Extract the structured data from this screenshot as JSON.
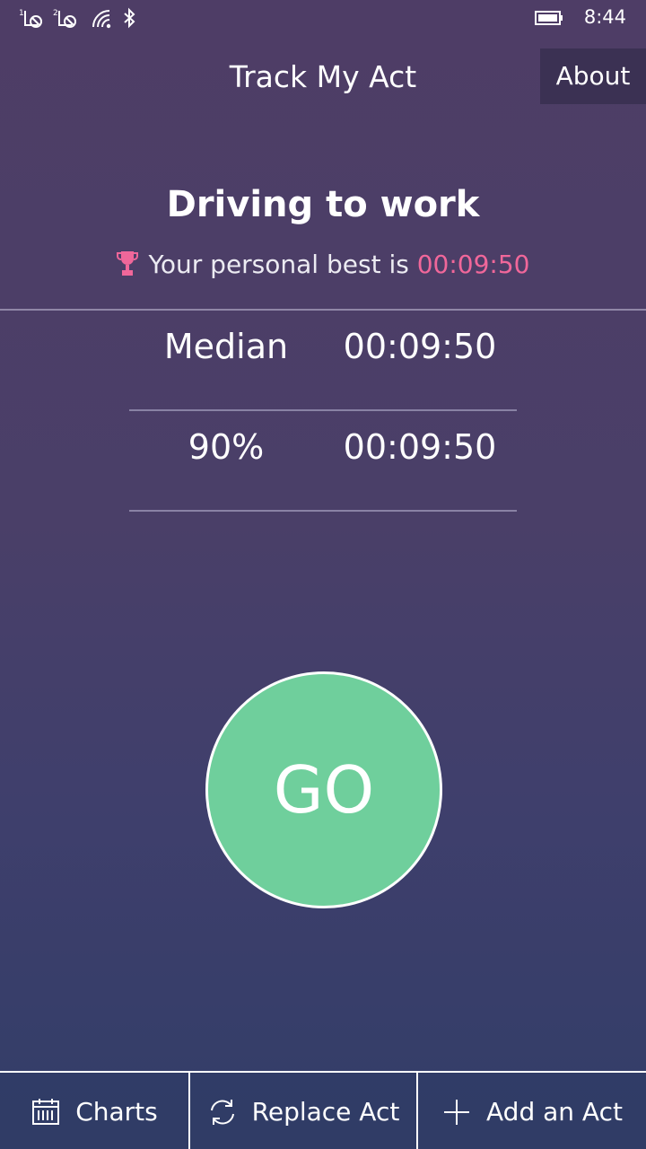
{
  "status_bar": {
    "time": "8:44",
    "sim1_label": "1",
    "sim2_label": "2",
    "icons": [
      "sim1-no-service-icon",
      "sim2-no-service-icon",
      "wifi-icon",
      "bluetooth-icon",
      "battery-icon"
    ]
  },
  "header": {
    "app_title": "Track My Act",
    "about_label": "About"
  },
  "act": {
    "title": "Driving to work",
    "best_prefix": "Your personal best is ",
    "best_value": "00:09:50",
    "best_color": "#f0679a",
    "trophy_icon": "trophy-icon"
  },
  "stats": [
    {
      "label": "Median",
      "value": "00:09:50"
    },
    {
      "label": "90%",
      "value": "00:09:50"
    }
  ],
  "go_button": {
    "label": "GO",
    "color": "#6fcf9c"
  },
  "bottom_bar": {
    "items": [
      {
        "label": "Charts",
        "icon": "calendar-icon"
      },
      {
        "label": "Replace Act",
        "icon": "refresh-icon"
      },
      {
        "label": "Add an Act",
        "icon": "plus-icon"
      }
    ]
  }
}
